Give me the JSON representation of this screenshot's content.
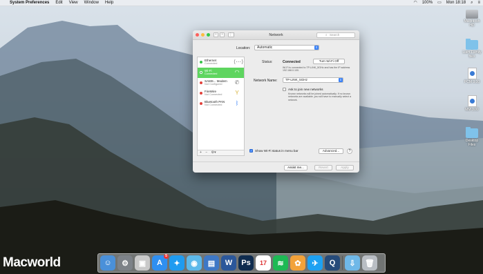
{
  "menubar": {
    "app_name": "System Preferences",
    "items": [
      "Edit",
      "View",
      "Window",
      "Help"
    ],
    "clock": "Mon 18:18",
    "battery": "100%"
  },
  "desktop_icons": [
    {
      "label": "Macintosh HD",
      "icon": "drive-icon"
    },
    {
      "label": "Liam Family files",
      "icon": "folder-icon"
    },
    {
      "label": "PCM 9.00",
      "icon": "document-icon"
    },
    {
      "label": "MM 3.00",
      "icon": "document-icon"
    },
    {
      "label": "Desktop Files",
      "icon": "folder-icon"
    }
  ],
  "window": {
    "title": "Network",
    "search_placeholder": "Search",
    "location_label": "Location:",
    "location_value": "Automatic",
    "services": [
      {
        "name": "Ethernet",
        "status": "Connected",
        "dot": "green",
        "icon": "ethernet-icon"
      },
      {
        "name": "Wi-Fi",
        "status": "Connected",
        "dot": "green",
        "icon": "wifi-icon",
        "selected": true
      },
      {
        "name": "SAMS... Modem",
        "status": "Not Configured",
        "dot": "red",
        "icon": "phone-icon"
      },
      {
        "name": "FireWire",
        "status": "Not Connected",
        "dot": "red",
        "icon": "firewire-icon"
      },
      {
        "name": "Bluetooth PAN",
        "status": "Not Connected",
        "dot": "red",
        "icon": "bluetooth-icon"
      }
    ],
    "sidebar_controls": [
      "+",
      "−",
      "⚙▾"
    ],
    "status_label": "Status:",
    "status_value": "Connected",
    "turn_off_button": "Turn Wi-Fi Off",
    "status_description": "Wi-Fi is connected to TP-LINK_5GHz and has the IP address 192.168.0.100.",
    "network_name_label": "Network Name:",
    "network_name_value": "TP-LINK_5GHz",
    "ask_join_label": "Ask to join new networks",
    "ask_join_description": "Known networks will be joined automatically. If no known networks are available, you will have to manually select a network.",
    "show_wifi_label": "Show Wi-Fi status in menu bar",
    "advanced_button": "Advanced...",
    "help_button": "?",
    "assist_button": "Assist me...",
    "revert_button": "Revert",
    "apply_button": "Apply"
  },
  "dock_items": [
    {
      "name": "Finder",
      "glyph": "☺",
      "color": "#4a90d9"
    },
    {
      "name": "System Preferences",
      "glyph": "⚙",
      "color": "#7d8288"
    },
    {
      "name": "Photo Viewer",
      "glyph": "▣",
      "color": "#c9c9c9"
    },
    {
      "name": "App Store",
      "glyph": "A",
      "color": "#2f8ff0",
      "badge": "5"
    },
    {
      "name": "Safari",
      "glyph": "✦",
      "color": "#1f9bf0"
    },
    {
      "name": "Tweetbot",
      "glyph": "◉",
      "color": "#5db9ea"
    },
    {
      "name": "Preview",
      "glyph": "▤",
      "color": "#3e78c6"
    },
    {
      "name": "Word",
      "glyph": "W",
      "color": "#2b579a"
    },
    {
      "name": "Photoshop",
      "glyph": "Ps",
      "color": "#0f2c4f"
    },
    {
      "name": "Calendar",
      "glyph": "17",
      "color": "#ffffff"
    },
    {
      "name": "Spotify",
      "glyph": "≋",
      "color": "#1db954"
    },
    {
      "name": "Photos",
      "glyph": "✿",
      "color": "#f2a23a"
    },
    {
      "name": "Twitter",
      "glyph": "✈",
      "color": "#1da1f2"
    },
    {
      "name": "QuickTime",
      "glyph": "Q",
      "color": "#264b7a"
    },
    {
      "name": "Downloads",
      "glyph": "⇩",
      "color": "#6fb8e8"
    },
    {
      "name": "Trash",
      "glyph": "🗑",
      "color": "#b9bec4"
    }
  ],
  "watermark": "Macworld"
}
